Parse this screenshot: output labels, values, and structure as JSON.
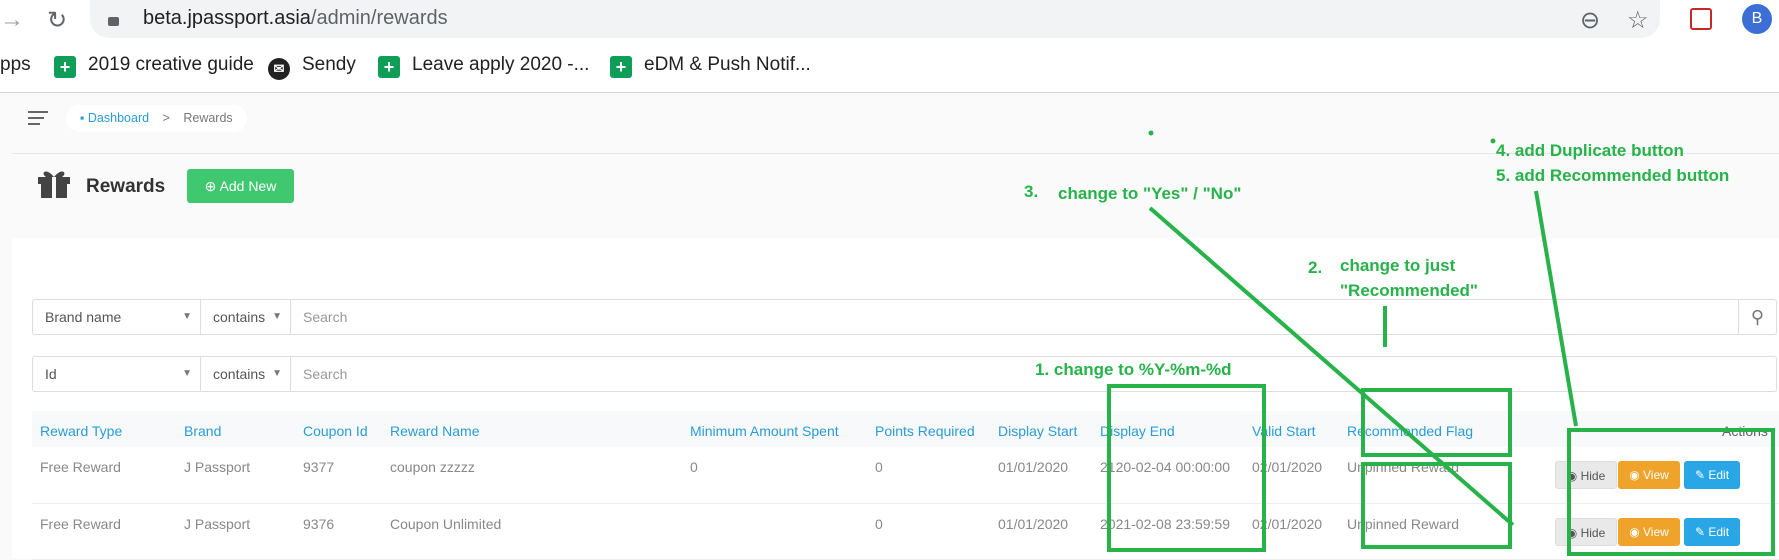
{
  "browser": {
    "url_host": "beta.jpassport.asia",
    "url_path": "/admin/rewards",
    "profile_initial": "B",
    "bookmarks": [
      "pps",
      "2019 creative guide",
      "Sendy",
      "Leave apply 2020 -...",
      "eDM & Push Notif..."
    ]
  },
  "breadcrumb": {
    "home": "Dashboard",
    "sep": ">",
    "current": "Rewards"
  },
  "page": {
    "title": "Rewards",
    "add_new": "Add New"
  },
  "filters": [
    {
      "field": "Brand name",
      "op": "contains",
      "placeholder": "Search"
    },
    {
      "field": "Id",
      "op": "contains",
      "placeholder": "Search"
    }
  ],
  "table": {
    "headers": [
      "Reward Type",
      "Brand",
      "Coupon Id",
      "Reward Name",
      "Minimum Amount Spent",
      "Points Required",
      "Display Start",
      "Display End",
      "Valid Start",
      "Recommended Flag",
      "Actions"
    ],
    "rows": [
      {
        "type": "Free Reward",
        "brand": "J Passport",
        "coupon_id": "9377",
        "name": "coupon zzzzz",
        "min_spent": "0",
        "points": "0",
        "display_start": "01/01/2020",
        "display_end": "2120-02-04 00:00:00",
        "valid_start": "02/01/2020",
        "flag": "Unpinned Reward"
      },
      {
        "type": "Free Reward",
        "brand": "J Passport",
        "coupon_id": "9376",
        "name": "Coupon Unlimited",
        "min_spent": "",
        "points": "0",
        "display_start": "01/01/2020",
        "display_end": "2021-02-08 23:59:59",
        "valid_start": "02/01/2020",
        "flag": "Unpinned Reward"
      }
    ],
    "actions": {
      "hide": "Hide",
      "view": "View",
      "edit": "Edit"
    }
  },
  "annotations": {
    "a1": "1. change to %Y-%m-%d",
    "a2_num": "2.",
    "a2_l1": "change to just",
    "a2_l2": "\"Recommended\"",
    "a3_num": "3.",
    "a3_text": "change to \"Yes\" / \"No\"",
    "a4": "4. add Duplicate button",
    "a5": "5. add Recommended button"
  },
  "colors": {
    "annotation": "#27b24a",
    "link": "#2a9bd6",
    "add_button": "#40c870",
    "view_button": "#f0a32b",
    "edit_button": "#29a6e6"
  },
  "icons": [
    "back-arrow-icon",
    "reload-icon",
    "lock-icon",
    "zoom-out-icon",
    "star-icon",
    "extension-icon",
    "menu-icon",
    "home-icon",
    "gift-icon",
    "plus-circle-icon",
    "caret-down-icon",
    "search-icon",
    "eye-icon",
    "edit-icon"
  ]
}
